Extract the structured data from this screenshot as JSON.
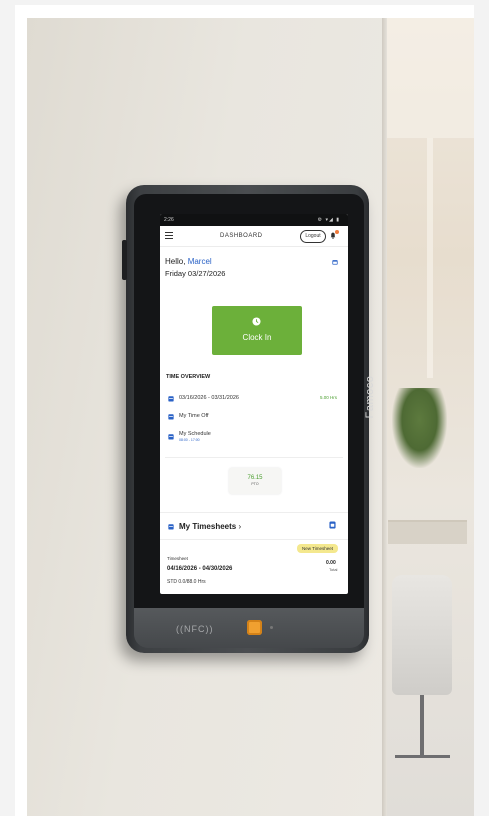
{
  "device": {
    "brand": "Famoco",
    "nfc_label": "((NFC))"
  },
  "statusbar": {
    "time": "2:26",
    "icons": "⚙ ▾◢ ▮"
  },
  "appbar": {
    "title": "DASHBOARD",
    "logout_label": "Logout"
  },
  "greeting": {
    "hello": "Hello, ",
    "name": "Marcel",
    "date": "Friday 03/27/2026"
  },
  "clock": {
    "label": "Clock In"
  },
  "time_overview": {
    "title": "TIME OVERVIEW",
    "period": "03/16/2026 - 03/31/2026",
    "hours": "5.00 Hrs",
    "time_off": "My Time Off",
    "schedule": "My Schedule",
    "schedule_hours": "08:00 - 17:00"
  },
  "pto": {
    "value": "76.15",
    "label": "PTO"
  },
  "timesheets": {
    "title": "My Timesheets",
    "chevron": "›",
    "new_label": "New Timesheet",
    "label": "Timesheet",
    "range": "04/16/2026 - 04/30/2026",
    "total_value": "0.00",
    "total_label": "Total",
    "std": "STD 0.0/88.0 Hrs"
  },
  "colors": {
    "accent_green": "#6cb03a",
    "link_blue": "#2a62c6",
    "badge_yellow": "#f4e88e",
    "reader_orange": "#f0a030"
  }
}
